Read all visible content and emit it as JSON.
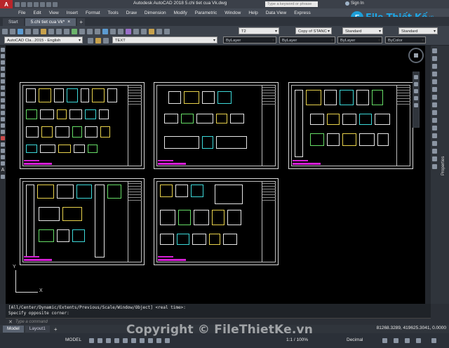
{
  "app": {
    "logo_letter": "A",
    "title": "Autodesk AutoCAD 2018    5.chi tiet cua Vk.dwg",
    "search_placeholder": "Type a keyword or phrase",
    "signin_label": "Sign In"
  },
  "menu": [
    "File",
    "Edit",
    "View",
    "Insert",
    "Format",
    "Tools",
    "Draw",
    "Dimension",
    "Modify",
    "Parametric",
    "Window",
    "Help",
    "Data View",
    "Express"
  ],
  "tabs": [
    {
      "label": "Start",
      "active": false
    },
    {
      "label": "5.chi tiet cua Vk*",
      "active": true
    }
  ],
  "ribbon": {
    "layer_combo": "T2",
    "textstyle_combo": "Copy of STANC",
    "dimstyle_combo": "Standard",
    "tablestyle_combo": "Standard",
    "workspace_combo": "AutoCAD Cla...2015 - English",
    "layer_name_combo": "TEXT",
    "color_combo": "ByLayer",
    "linetype_combo": "ByLayer",
    "lineweight_combo": "ByLayer",
    "plotstyle_combo": "ByColor"
  },
  "brand": {
    "mark": "F",
    "name": "File Thiết Kế",
    "domain": ".vn"
  },
  "palette": {
    "text_tool": "A",
    "properties_label": "Properties"
  },
  "ucs": {
    "x_label": "X",
    "y_label": "Y"
  },
  "command": {
    "history_1": "[All/Center/Dynamic/Extents/Previous/Scale/Window/Object] <real time>:",
    "history_2": "Specify opposite corner:",
    "input_placeholder": "Type a command",
    "close_glyph": "✕"
  },
  "layout_tabs": [
    {
      "label": "Model",
      "active": true
    },
    {
      "label": "Layout1",
      "active": false
    }
  ],
  "coordinates": "81268.3289, 419625.3041, 0.0000",
  "status": {
    "mode": "MODEL",
    "scale": "1:1 / 100%",
    "units": "Decimal"
  },
  "watermark": "Copyright © FileThietKe.vn"
}
